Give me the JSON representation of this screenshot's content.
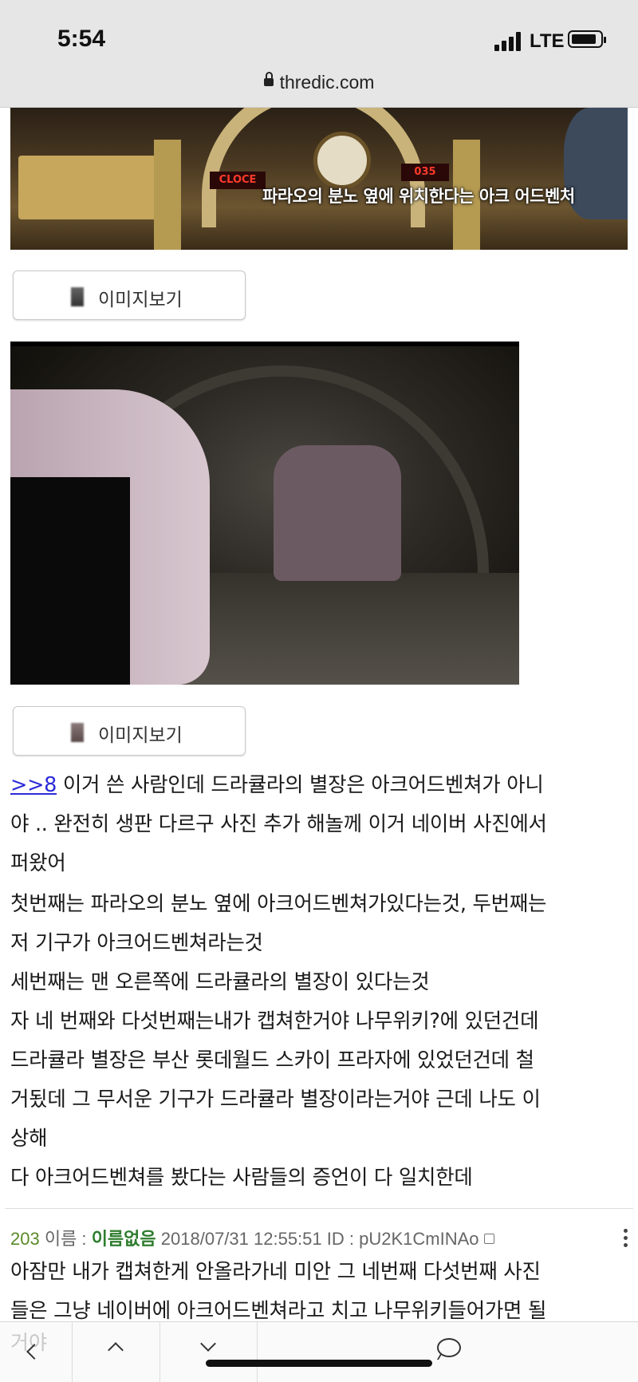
{
  "status_bar": {
    "time": "5:54",
    "network": "LTE"
  },
  "browser": {
    "url": "thredic.com"
  },
  "image1": {
    "caption": "파라오의 분노 옆에 위치한다는 아크 어드벤처",
    "sign_left": "CLOCE",
    "sign_right": "035"
  },
  "view_image_label": "이미지보기",
  "post": {
    "reply_link": ">>8",
    "lines": [
      " 이거 쓴 사람인데 드라큘라의 별장은 아크어드벤쳐가 아니",
      "야 .. 완전히 생판 다르구 사진 추가 해놀께 이거 네이버 사진에서",
      "퍼왔어",
      "첫번째는 파라오의 분노 옆에 아크어드벤쳐가있다는것, 두번째는",
      "저 기구가 아크어드벤쳐라는것",
      "세번째는 맨 오른쪽에 드라큘라의 별장이 있다는것",
      "자 네 번째와  다섯번째는내가 캡쳐한거야 나무위키?에 있던건데",
      "드라큘라 별장은 부산 롯데월드 스카이 프라자에 있었던건데 철",
      "거됬데 그 무서운 기구가 드라큘라 별장이라는거야 근데 나도 이",
      "상해",
      "다 아크어드벤쳐를 봤다는 사람들의 증언이 다 일치한데"
    ]
  },
  "reply": {
    "number": "203",
    "name_label": "이름 :",
    "name": "이름없음",
    "datetime": "2018/07/31 12:55:51",
    "id_label": "ID :",
    "id": "pU2K1CmINAo",
    "lines": [
      "아잠만 내가 캡쳐한게 안올라가네 미안 그 네번째 다섯번째 사진",
      "들은 그냥 네이버에 아크어드벤쳐라고 치고 나무위키들어가면 될"
    ],
    "cut_off_text": "거야"
  },
  "toolbar": {
    "icons": [
      "back-icon",
      "up-icon",
      "down-icon",
      "comment-icon"
    ]
  }
}
